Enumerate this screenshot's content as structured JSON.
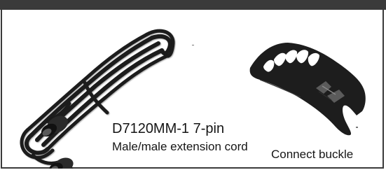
{
  "cable": {
    "title": "D7120MM-1 7-pin",
    "description": "Male/male extension cord"
  },
  "buckle": {
    "label": "Connect buckle"
  },
  "icons": {
    "cable_image": "coiled-extension-cord",
    "buckle_image": "connect-buckle-clip"
  },
  "colors": {
    "frame": "#3a3a3a",
    "cable": "#1a1a1a",
    "buckle": "#1d1d1d"
  }
}
